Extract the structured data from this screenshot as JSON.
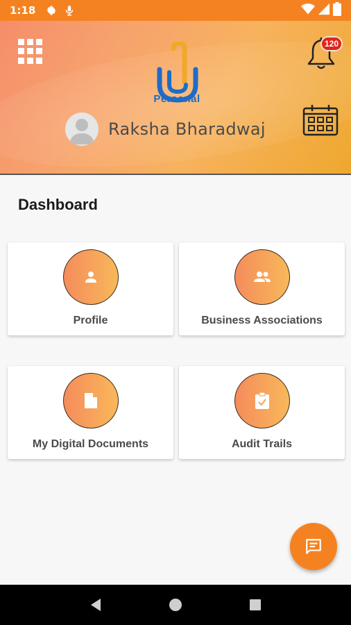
{
  "status_bar": {
    "time": "1:18",
    "icons": [
      "gear-icon",
      "mic-icon",
      "wifi-icon",
      "signal-icon",
      "battery-icon"
    ]
  },
  "header": {
    "logo_text": "Personal",
    "user_name": "Raksha Bharadwaj",
    "notification_count": "120",
    "colors": {
      "gradient_start": "#f58d6b",
      "gradient_end": "#eea82f",
      "logo_blue": "#1e6cc8"
    }
  },
  "dashboard": {
    "title": "Dashboard",
    "cards": [
      {
        "label": "Profile",
        "icon": "person-icon"
      },
      {
        "label": "Business Associations",
        "icon": "people-icon"
      },
      {
        "label": "My Digital Documents",
        "icon": "document-icon"
      },
      {
        "label": "Audit Trails",
        "icon": "clipboard-check-icon"
      }
    ]
  },
  "fab": {
    "icon": "chat-icon"
  },
  "nav_bar": {
    "icons": [
      "back-icon",
      "home-icon",
      "recents-icon"
    ]
  },
  "accent_color": "#f58220"
}
